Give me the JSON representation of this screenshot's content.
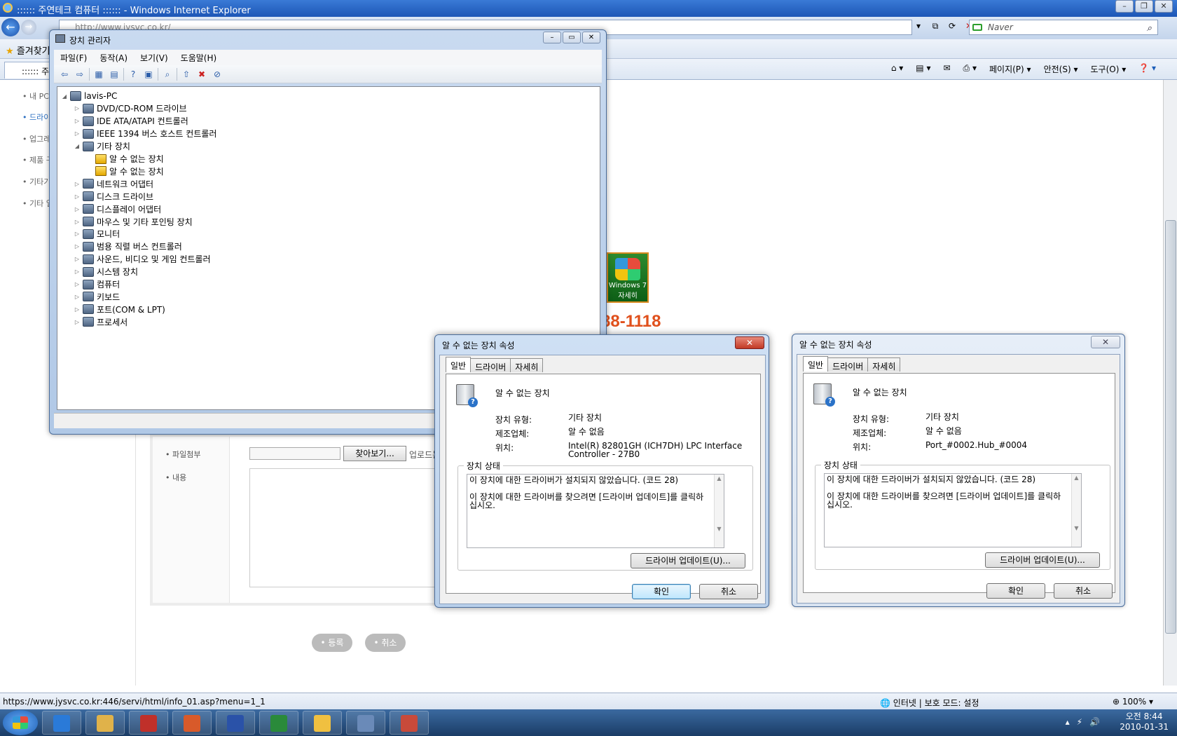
{
  "ie": {
    "title": ":::::: 주연테크 컴퓨터 :::::: - Windows Internet Explorer",
    "address": "http://www.jysvc.co.kr/",
    "search_placeholder": "Naver",
    "favorites_label": "즐겨찾기",
    "tab_label": ":::::: 주연",
    "commands": [
      "페이지(P)",
      "안전(S)",
      "도구(O)"
    ],
    "status_url": "https://www.jysvc.co.kr:446/servi/html/info_01.asp?menu=1_1",
    "status_zone": "인터넷 | 보호 모드: 설정",
    "zoom": "100%"
  },
  "page": {
    "leftnav": [
      "• 내 PC정",
      "• 드라이",
      "• 업그레",
      "• 제품 구",
      "• 기타기",
      "• 기타 일"
    ],
    "form": {
      "attach_label": "• 파일첨부",
      "browse_label": "찾아보기...",
      "upload_note": "업로드는 1M",
      "content_label": "• 내용"
    },
    "submit_label": "• 등록",
    "cancel_label": "• 취소",
    "win7_text": "Windows 7",
    "win7_sub": "자세히",
    "phone": "88-1118"
  },
  "device_manager": {
    "title": "장치 관리자",
    "menu": [
      "파일(F)",
      "동작(A)",
      "보기(V)",
      "도움말(H)"
    ],
    "root": "lavis-PC",
    "tree": [
      {
        "label": "DVD/CD-ROM 드라이브",
        "level": 1,
        "expand": "▷"
      },
      {
        "label": "IDE ATA/ATAPI 컨트롤러",
        "level": 1,
        "expand": "▷"
      },
      {
        "label": "IEEE 1394 버스 호스트 컨트롤러",
        "level": 1,
        "expand": "▷"
      },
      {
        "label": "기타 장치",
        "level": 1,
        "expand": "◢"
      },
      {
        "label": "알 수 없는 장치",
        "level": 2,
        "expand": "",
        "warn": true
      },
      {
        "label": "알 수 없는 장치",
        "level": 2,
        "expand": "",
        "warn": true
      },
      {
        "label": "네트워크 어댑터",
        "level": 1,
        "expand": "▷"
      },
      {
        "label": "디스크 드라이브",
        "level": 1,
        "expand": "▷"
      },
      {
        "label": "디스플레이 어댑터",
        "level": 1,
        "expand": "▷"
      },
      {
        "label": "마우스 및 기타 포인팅 장치",
        "level": 1,
        "expand": "▷"
      },
      {
        "label": "모니터",
        "level": 1,
        "expand": "▷"
      },
      {
        "label": "범용 직렬 버스 컨트롤러",
        "level": 1,
        "expand": "▷"
      },
      {
        "label": "사운드, 비디오 및 게임 컨트롤러",
        "level": 1,
        "expand": "▷"
      },
      {
        "label": "시스템 장치",
        "level": 1,
        "expand": "▷"
      },
      {
        "label": "컴퓨터",
        "level": 1,
        "expand": "▷"
      },
      {
        "label": "키보드",
        "level": 1,
        "expand": "▷"
      },
      {
        "label": "포트(COM & LPT)",
        "level": 1,
        "expand": "▷"
      },
      {
        "label": "프로세서",
        "level": 1,
        "expand": "▷"
      }
    ]
  },
  "dialog1": {
    "title": "알 수 없는 장치 속성",
    "tabs": [
      "일반",
      "드라이버",
      "자세히"
    ],
    "device_name": "알 수 없는 장치",
    "type_label": "장치 유형:",
    "type_value": "기타 장치",
    "mfr_label": "제조업체:",
    "mfr_value": "알 수 없음",
    "loc_label": "위치:",
    "loc_value": "Intel(R) 82801GH (ICH7DH) LPC Interface Controller - 27B0",
    "status_group": "장치 상태",
    "status_line1": "이 장치에 대한 드라이버가 설치되지 않았습니다. (코드 28)",
    "status_line2": "이 장치에 대한 드라이버를 찾으려면 [드라이버 업데이트]를 클릭하십시오.",
    "update_btn": "드라이버 업데이트(U)...",
    "ok": "확인",
    "cancel": "취소"
  },
  "dialog2": {
    "title": "알 수 없는 장치 속성",
    "tabs": [
      "일반",
      "드라이버",
      "자세히"
    ],
    "device_name": "알 수 없는 장치",
    "type_label": "장치 유형:",
    "type_value": "기타 장치",
    "mfr_label": "제조업체:",
    "mfr_value": "알 수 없음",
    "loc_label": "위치:",
    "loc_value": "Port_#0002.Hub_#0004",
    "status_group": "장치 상태",
    "status_line1": "이 장치에 대한 드라이버가 설치되지 않았습니다. (코드 28)",
    "status_line2": "이 장치에 대한 드라이버를 찾으려면 [드라이버 업데이트]를 클릭하십시오.",
    "update_btn": "드라이버 업데이트(U)...",
    "ok": "확인",
    "cancel": "취소"
  },
  "taskbar": {
    "time": "오전 8:44",
    "date": "2010-01-31",
    "apps": [
      "ie-icon",
      "explorer-icon",
      "acrobat-icon",
      "powerpoint-icon",
      "word-icon",
      "excel-icon",
      "messenger-icon",
      "device-manager-icon",
      "toolbox-icon"
    ]
  }
}
